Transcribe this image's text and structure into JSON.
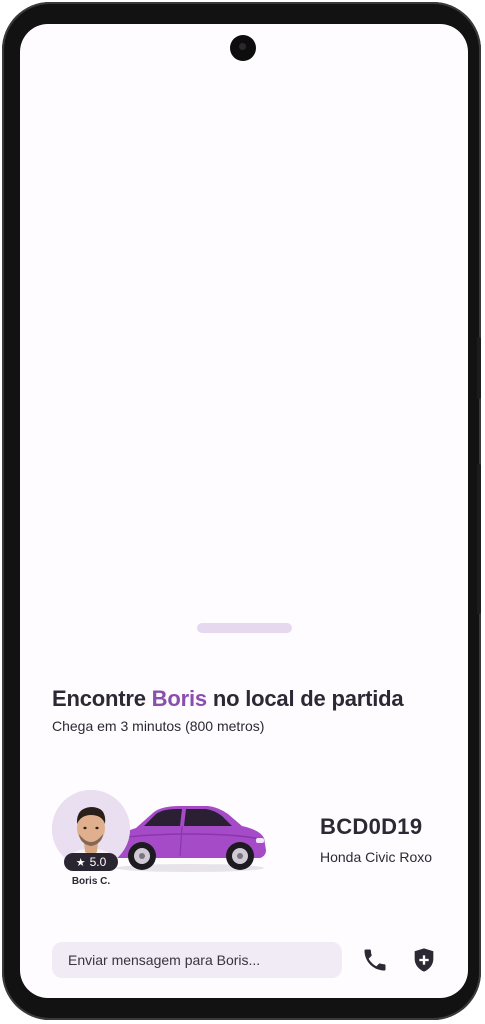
{
  "trip": {
    "headline_prefix": "Encontre ",
    "driver_first_name": "Boris",
    "headline_suffix": " no local de partida",
    "arrival_info": "Chega em 3 minutos (800 metros)"
  },
  "driver": {
    "name": "Boris C.",
    "rating": "5.0",
    "avatar_icon": "driver-avatar-photo"
  },
  "vehicle": {
    "plate": "BCD0D19",
    "model": "Honda Civic Roxo",
    "color": "#a64bc8",
    "icon": "car-illustration"
  },
  "actions": {
    "message_placeholder": "Enviar mensagem para Boris...",
    "call_icon": "phone-icon",
    "safety_icon": "shield-plus-icon"
  },
  "theme": {
    "accent": "#8a4fae",
    "text": "#2e2834",
    "surface": "#f1ebf6",
    "handle": "#e6d8ef"
  }
}
